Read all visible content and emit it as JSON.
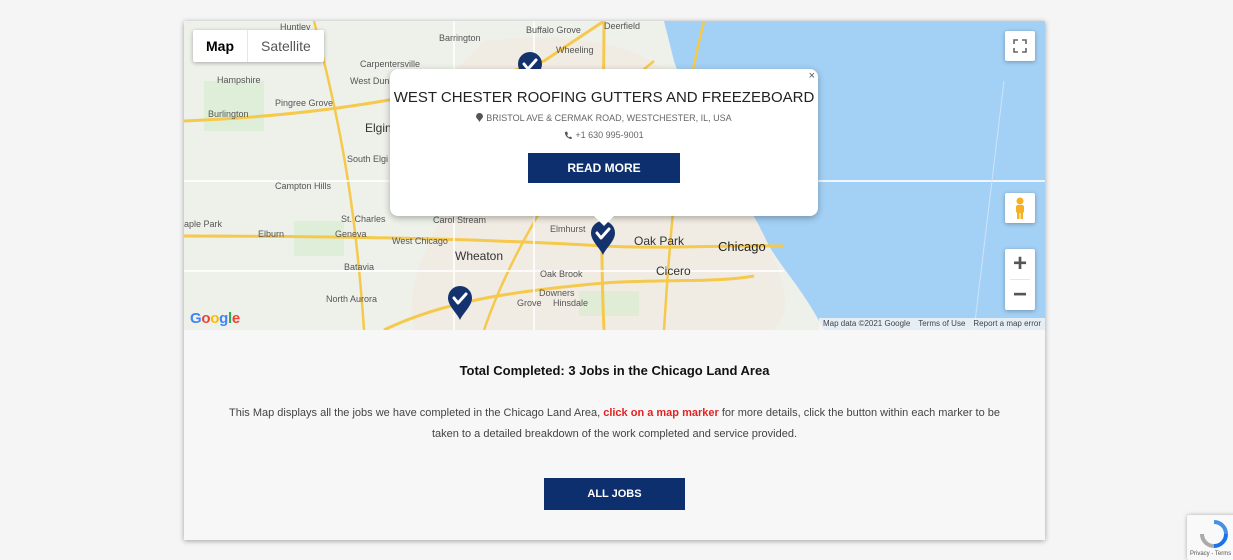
{
  "map": {
    "type_control": {
      "map_label": "Map",
      "satellite_label": "Satellite"
    },
    "zoom_in_label": "+",
    "zoom_out_label": "−",
    "attribution": {
      "data": "Map data ©2021 Google",
      "terms": "Terms of Use",
      "report": "Report a map error"
    },
    "google_logo": "Google",
    "place_labels": {
      "huntley": "Huntley",
      "barrington": "Barrington",
      "buffalo_grove": "Buffalo Grove",
      "deerfield": "Deerfield",
      "wheeling": "Wheeling",
      "carpentersville": "Carpentersville",
      "hampshire": "Hampshire",
      "west_dundee": "West Dun",
      "pingree_grove": "Pingree Grove",
      "burlington": "Burlington",
      "elgin": "Elgin",
      "south_elgin": "South Elgi",
      "campton_hills": "Campton Hills",
      "st_charles": "St. Charles",
      "carol_stream": "Carol Stream",
      "elmhurst": "Elmhurst",
      "oak_park": "Oak Park",
      "chicago": "Chicago",
      "maple_park": "aple Park",
      "elburn": "Elburn",
      "geneva": "Geneva",
      "west_chicago": "West Chicago",
      "wheaton": "Wheaton",
      "cicero": "Cicero",
      "oak_brook": "Oak Brook",
      "batavia": "Batavia",
      "downers_grove_1": "Downers",
      "downers_grove_2": "Grove",
      "hinsdale": "Hinsdale",
      "north_aurora": "North Aurora"
    },
    "markers_completed": 3
  },
  "info_window": {
    "close_symbol": "×",
    "title": "WEST CHESTER ROOFING GUTTERS AND FREEZEBOARD",
    "address": "BRISTOL AVE & CERMAK ROAD, WESTCHESTER, IL, USA",
    "phone": "+1 630 995-9001",
    "read_more": "READ MORE"
  },
  "content": {
    "total": "Total Completed: 3 Jobs in the Chicago Land Area",
    "desc_before": "This Map displays all the jobs we have completed in the Chicago Land Area, ",
    "desc_highlight": "click on a map marker",
    "desc_after": " for more details, click the button within each marker to be taken to a detailed breakdown of the work completed and service provided.",
    "all_jobs": "ALL JOBS"
  },
  "recaptcha": {
    "text": "Privacy - Terms"
  },
  "colors": {
    "brand_navy": "#0e2f6e",
    "highlight_red": "#e52222",
    "water": "#a3d0f5"
  }
}
